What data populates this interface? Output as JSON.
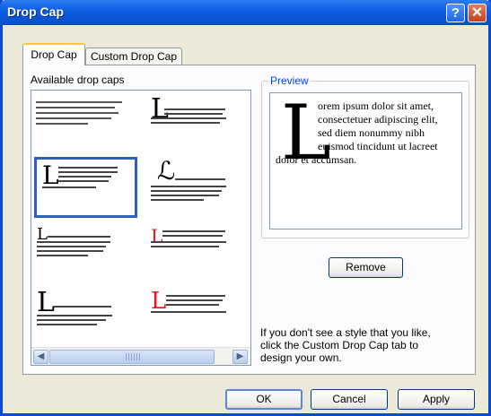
{
  "window": {
    "title": "Drop Cap"
  },
  "title_buttons": {
    "help": "?",
    "close": "✕"
  },
  "tabs": [
    {
      "label": "Drop Cap",
      "active": true
    },
    {
      "label": "Custom Drop Cap",
      "active": false
    }
  ],
  "gallery": {
    "label": "Available drop caps",
    "items": [
      {
        "name": "none",
        "cap": "",
        "cap_color": "#000000",
        "selected": false
      },
      {
        "name": "drop-3-lines",
        "cap": "L",
        "cap_color": "#000000",
        "selected": false
      },
      {
        "name": "drop-2-lines-boxed",
        "cap": "L",
        "cap_color": "#000000",
        "selected": true
      },
      {
        "name": "script-swash",
        "cap": "ℒ",
        "cap_color": "#000000",
        "selected": false
      },
      {
        "name": "small-drop",
        "cap": "L",
        "cap_color": "#000000",
        "selected": false
      },
      {
        "name": "red-drop",
        "cap": "L",
        "cap_color": "#e0161c",
        "selected": false
      },
      {
        "name": "raised-large",
        "cap": "L",
        "cap_color": "#000000",
        "selected": false
      },
      {
        "name": "red-drop-large",
        "cap": "L",
        "cap_color": "#e0161c",
        "selected": false
      }
    ],
    "scroll_left_icon": "arrow-left-icon",
    "scroll_right_icon": "arrow-right-icon"
  },
  "preview": {
    "label": "Preview",
    "drop_cap": "L",
    "lines": [
      "orem ipsum dolor sit amet,",
      "consectetuer adipiscing elit,",
      "sed diem nonummy nibh",
      "euismod tincidunt ut lacreet",
      "dolor et accumsan."
    ]
  },
  "remove_button": "Remove",
  "hint": "If you don't see a style that you like, click the Custom Drop Cap tab to design your own.",
  "footer": {
    "ok": "OK",
    "cancel": "Cancel",
    "apply": "Apply"
  }
}
